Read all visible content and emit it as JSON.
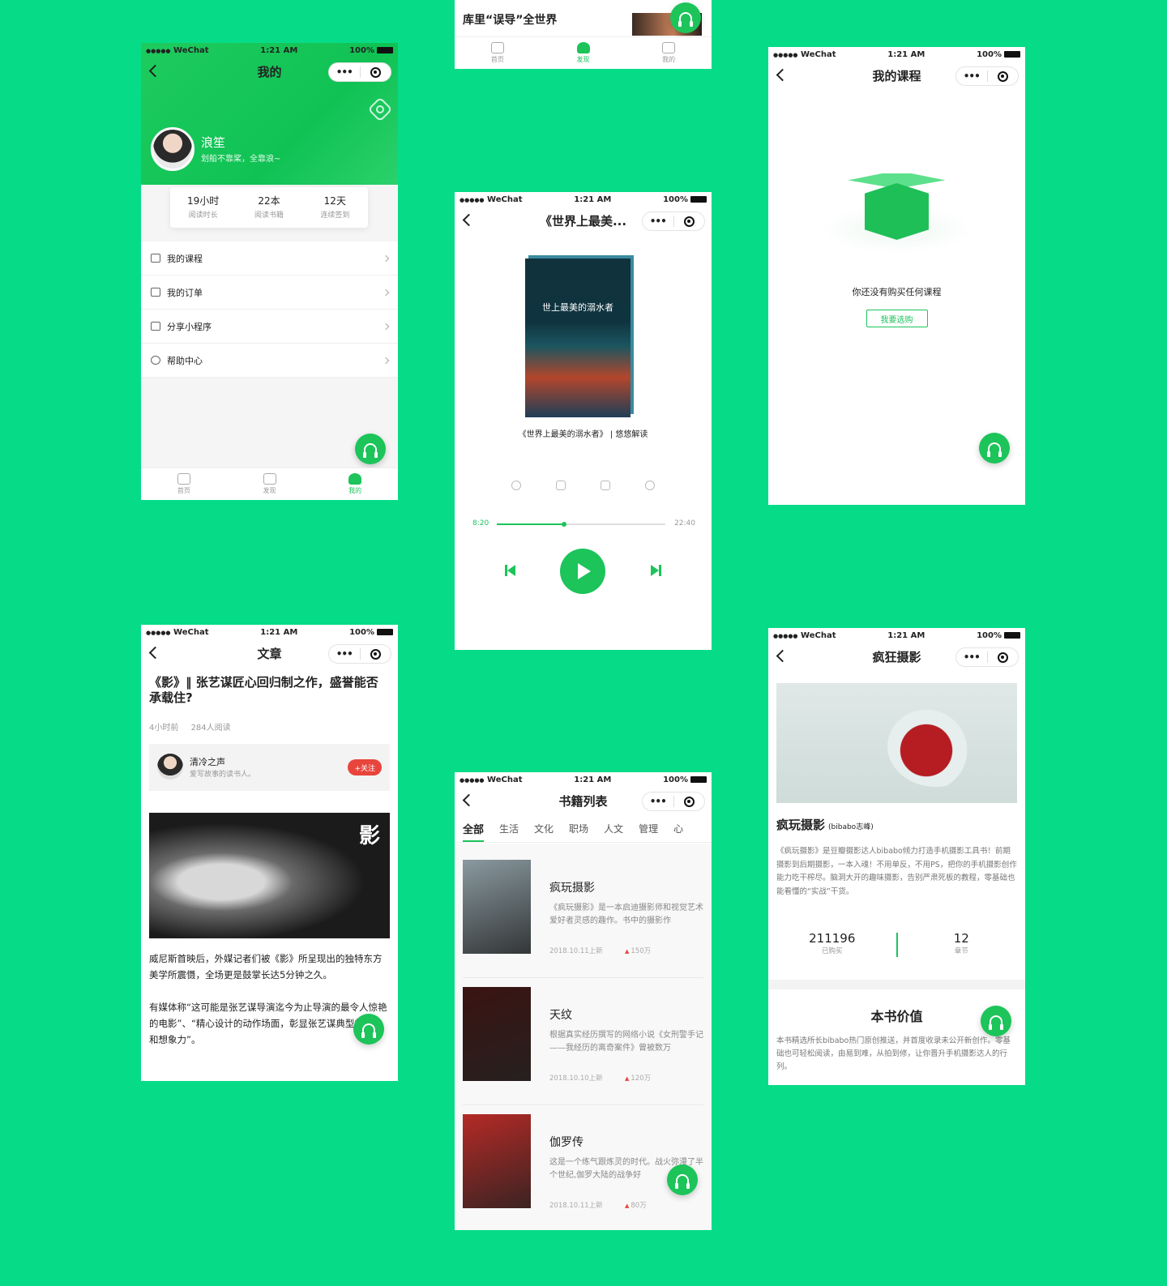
{
  "status_bar": {
    "carrier": "WeChat",
    "time": "1:21 AM",
    "battery": "100%"
  },
  "capsule": {
    "more": "•••"
  },
  "tabbar": {
    "home": "首页",
    "discover": "发现",
    "mine": "我的"
  },
  "profile": {
    "title": "我的",
    "username": "浪笙",
    "signature": "划船不靠桨，全靠浪~",
    "stats": [
      {
        "value": "19小时",
        "label": "阅读时长"
      },
      {
        "value": "22本",
        "label": "阅读书籍"
      },
      {
        "value": "12天",
        "label": "连续签到"
      }
    ],
    "menu": [
      "我的课程",
      "我的订单",
      "分享小程序",
      "帮助中心"
    ]
  },
  "discover": {
    "headline": "库里“误导”全世界"
  },
  "courses": {
    "title": "我的课程",
    "empty_text": "你还没有购买任何课程",
    "buy_button": "我要选购"
  },
  "player": {
    "title": "《世界上最美...",
    "cover_title": "世上最美的溺水者",
    "track_title": "《世界上最美的溺水者》 | 悠悠解读",
    "time_current": "8:20",
    "time_total": "22:40",
    "progress": 0.4
  },
  "article": {
    "title": "文章",
    "headline": "《影》‖ 张艺谋匠心回归制之作，盛誉能否承载住?",
    "time": "4小时前",
    "reads": "284人阅读",
    "author_name": "清冷之声",
    "author_bio": "爱写故事的读书人。",
    "follow": "+关注",
    "photo_char": "影",
    "para1": "威尼斯首映后，外媒记者们被《影》所呈现出的独特东方美学所震慑，全场更是鼓掌长达5分钟之久。",
    "para2": "有媒体称“这可能是张艺谋导演迄今为止导演的最令人惊艳的电影”、“精心设计的动作场面，彰显张艺谋典型的气韵和想象力”。"
  },
  "books": {
    "title": "书籍列表",
    "categories": [
      "全部",
      "生活",
      "文化",
      "职场",
      "人文",
      "管理",
      "心"
    ],
    "items": [
      {
        "title": "疯玩摄影",
        "desc": "《疯玩摄影》是一本启迪摄影师和视觉艺术爱好者灵感的趣作。书中的摄影作",
        "date": "2018.10.11上新",
        "heat": "150万",
        "color": "#8a9aa0"
      },
      {
        "title": "天纹",
        "desc": "根据真实经历撰写的网络小说《女刑警手记——我经历的离奇案件》曾被数万",
        "date": "2018.10.10上新",
        "heat": "120万",
        "color": "#3a1412"
      },
      {
        "title": "伽罗传",
        "desc": "这是一个练气跟炼灵的时代。战火弥漫了半个世纪,伽罗大陆的战争好",
        "date": "2018.10.11上新",
        "heat": "80万",
        "color": "#b52a26"
      }
    ]
  },
  "detail": {
    "title": "疯狂摄影",
    "book_title": "疯玩摄影",
    "author": "(bibabo志峰)",
    "desc": "《疯玩摄影》是豆瓣摄影达人bibabo倾力打造手机摄影工具书！前期摄影到后期摄影，一本入魂！不用单反，不用PS，把你的手机摄影创作能力吃干榨尽。脑洞大开的趣味摄影，告别严肃死板的教程，零基础也能看懂的“实战”干货。",
    "purchased": "211196",
    "purchased_label": "已购买",
    "chapters": "12",
    "chapters_label": "章节",
    "value_title": "本书价值",
    "value_desc": "本书精选所长bibabo热门原创推送，并首度收录未公开新创作。零基础也可轻松阅读，由易到难，从拍到修，让你晋升手机摄影达人的行列。"
  }
}
